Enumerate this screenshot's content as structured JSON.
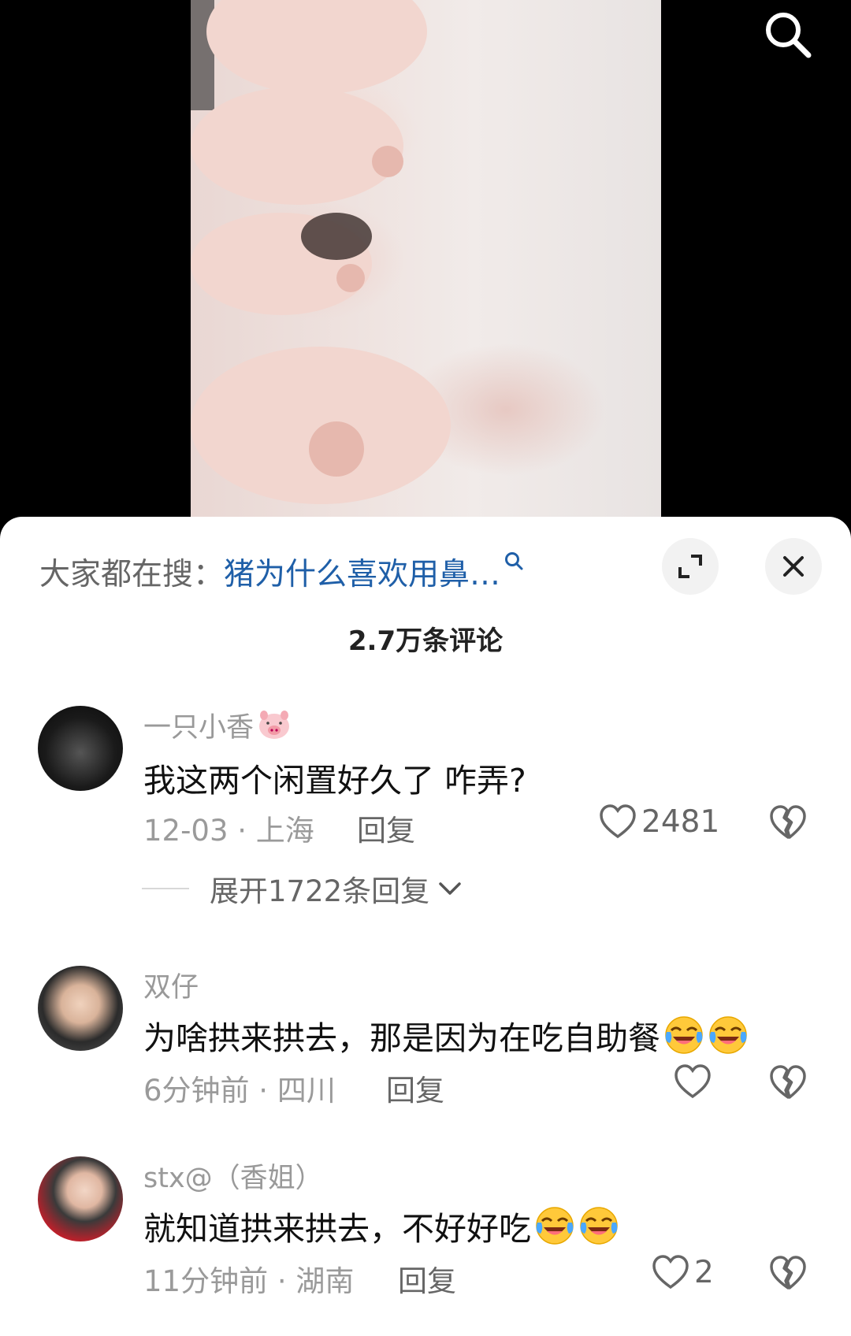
{
  "hot_search": {
    "prefix": "大家都在搜：",
    "query": "猪为什么喜欢用鼻…"
  },
  "comment_count": "2.7万条评论",
  "comments": [
    {
      "username": "一只小香",
      "username_emoji": "pig-face-emoji",
      "text": "我这两个闲置好久了  咋弄?",
      "meta": "12-03 · 上海",
      "reply_label": "回复",
      "likes": "2481",
      "expand_label": "展开1722条回复"
    },
    {
      "username": "双仔",
      "text": "为啥拱来拱去，那是因为在吃自助餐",
      "emojis": [
        "crying-laughing-emoji",
        "crying-laughing-emoji"
      ],
      "meta": "6分钟前 · 四川",
      "reply_label": "回复",
      "likes": ""
    },
    {
      "username": "stx@（香姐）",
      "text": "就知道拱来拱去，不好好吃",
      "emojis": [
        "crying-laughing-emoji",
        "crying-laughing-emoji"
      ],
      "meta": "11分钟前 · 湖南",
      "reply_label": "回复",
      "likes": "2"
    }
  ],
  "colors": {
    "accent_link": "#1f5fa8",
    "meta_gray": "#9a9a9a"
  }
}
